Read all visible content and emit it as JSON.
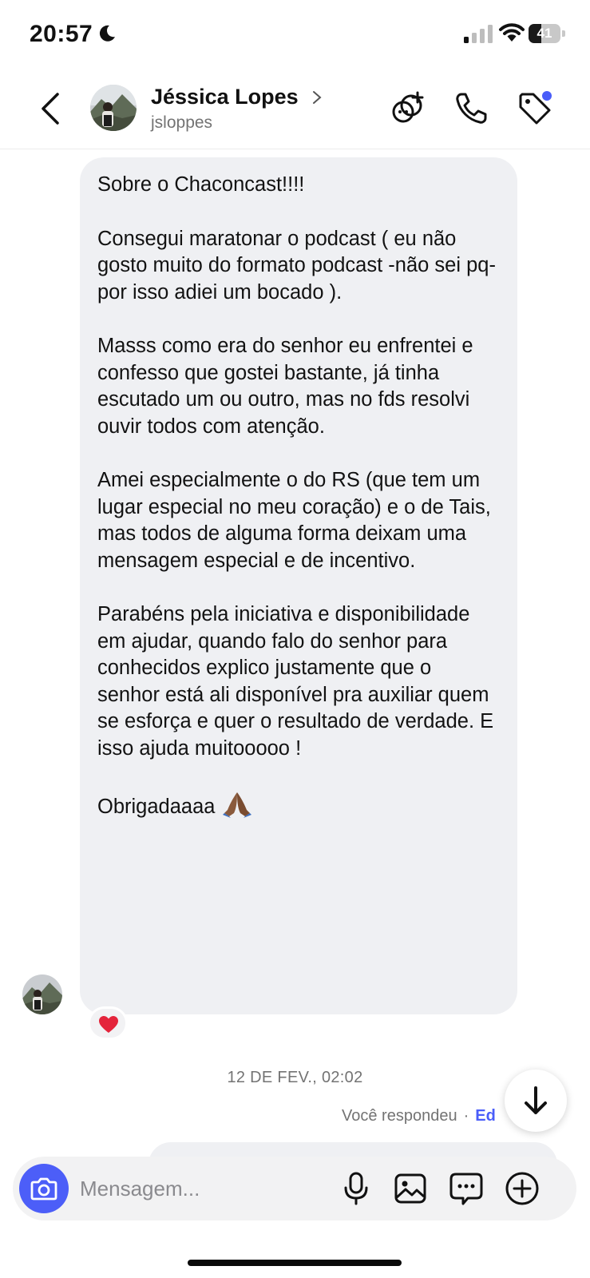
{
  "status_bar": {
    "time": "20:57",
    "battery_level": "41",
    "battery_fraction": 0.41
  },
  "header": {
    "contact_name": "Jéssica Lopes",
    "username": "jsloppes",
    "icons": [
      "back-chevron-icon",
      "add-to-group-icon",
      "phone-icon",
      "tag-icon"
    ],
    "notification_dot_color": "#4a5df9"
  },
  "message": {
    "paragraphs": [
      "Sobre o Chaconcast!!!!",
      "Consegui maratonar o podcast ( eu não gosto muito do formato podcast -não sei pq- por isso adiei um bocado ).",
      "Masss como era do senhor eu enfrentei e confesso que gostei bastante, já tinha escutado um ou outro, mas no fds resolvi ouvir todos com atenção.",
      "Amei especialmente o do RS (que tem um lugar especial no meu coração) e o de Tais, mas todos de alguma forma deixam uma mensagem especial e de incentivo.",
      "Parabéns pela iniciativa e disponibilidade em ajudar, quando falo do senhor para conhecidos explico justamente que o senhor está ali disponível pra auxiliar quem se esforça e quer o resultado de verdade. E isso ajuda muitooooo !",
      "Obrigadaaaa"
    ],
    "emoji": "praying-hands-icon",
    "reaction": "red-heart-icon"
  },
  "timestamp": "12 DE FEV., 02:02",
  "reply_note": {
    "text": "Você respondeu",
    "dot": "·",
    "edit": "Ed"
  },
  "composer": {
    "placeholder": "Mensagem...",
    "icons": [
      "camera-icon",
      "microphone-icon",
      "gallery-icon",
      "sticker-chat-icon",
      "plus-circle-icon"
    ]
  },
  "colors": {
    "accent": "#4c5ef8",
    "bubble": "#eff0f3",
    "secondary_text": "#737373"
  }
}
